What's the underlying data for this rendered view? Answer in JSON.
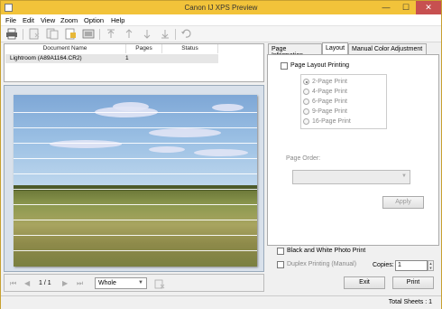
{
  "window": {
    "title": "Canon IJ XPS Preview",
    "minimize": "—",
    "maximize": "☐",
    "close": "✕"
  },
  "menu": [
    "File",
    "Edit",
    "View",
    "Zoom",
    "Option",
    "Help"
  ],
  "doclist": {
    "headers": {
      "name": "Document Name",
      "pages": "Pages",
      "status": "Status"
    },
    "rows": [
      {
        "name": "Lightroom (A89A1164.CR2)",
        "pages": "1",
        "status": ""
      }
    ]
  },
  "nav": {
    "page_indicator": "1 / 1",
    "zoom_value": "Whole"
  },
  "tabs": {
    "page_info": "Page Information",
    "layout": "Layout",
    "color": "Manual Color Adjustment"
  },
  "layout": {
    "page_layout_printing": "Page Layout Printing",
    "options": [
      "2-Page Print",
      "4-Page Print",
      "6-Page Print",
      "9-Page Print",
      "16-Page Print"
    ],
    "selected": "2-Page Print",
    "page_order_label": "Page Order:",
    "apply": "Apply"
  },
  "bottom": {
    "bw_photo": "Black and White Photo Print",
    "duplex": "Duplex Printing (Manual)",
    "copies_label": "Copies:",
    "copies_value": "1",
    "exit": "Exit",
    "print": "Print"
  },
  "status": {
    "total_sheets": "Total Sheets :  1"
  },
  "colors": {
    "titlebar": "#f2c33a",
    "close": "#c75050"
  }
}
